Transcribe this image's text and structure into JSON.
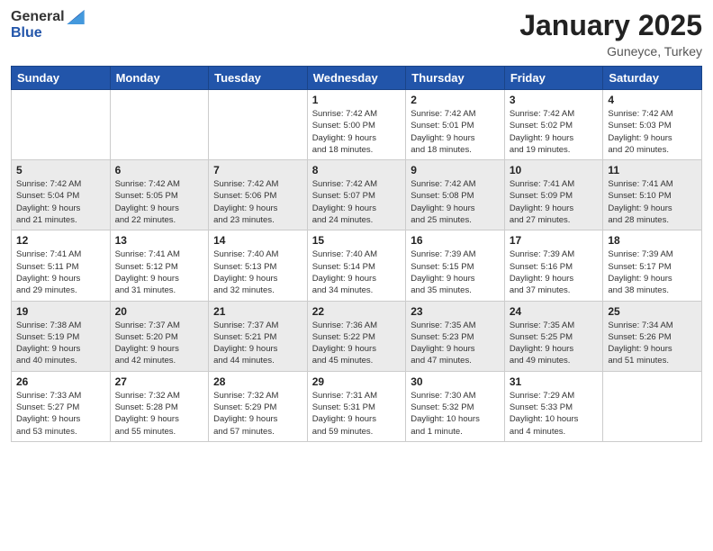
{
  "logo": {
    "general": "General",
    "blue": "Blue"
  },
  "title": "January 2025",
  "location": "Guneyce, Turkey",
  "days_of_week": [
    "Sunday",
    "Monday",
    "Tuesday",
    "Wednesday",
    "Thursday",
    "Friday",
    "Saturday"
  ],
  "weeks": [
    [
      {
        "day": "",
        "info": ""
      },
      {
        "day": "",
        "info": ""
      },
      {
        "day": "",
        "info": ""
      },
      {
        "day": "1",
        "info": "Sunrise: 7:42 AM\nSunset: 5:00 PM\nDaylight: 9 hours\nand 18 minutes."
      },
      {
        "day": "2",
        "info": "Sunrise: 7:42 AM\nSunset: 5:01 PM\nDaylight: 9 hours\nand 18 minutes."
      },
      {
        "day": "3",
        "info": "Sunrise: 7:42 AM\nSunset: 5:02 PM\nDaylight: 9 hours\nand 19 minutes."
      },
      {
        "day": "4",
        "info": "Sunrise: 7:42 AM\nSunset: 5:03 PM\nDaylight: 9 hours\nand 20 minutes."
      }
    ],
    [
      {
        "day": "5",
        "info": "Sunrise: 7:42 AM\nSunset: 5:04 PM\nDaylight: 9 hours\nand 21 minutes."
      },
      {
        "day": "6",
        "info": "Sunrise: 7:42 AM\nSunset: 5:05 PM\nDaylight: 9 hours\nand 22 minutes."
      },
      {
        "day": "7",
        "info": "Sunrise: 7:42 AM\nSunset: 5:06 PM\nDaylight: 9 hours\nand 23 minutes."
      },
      {
        "day": "8",
        "info": "Sunrise: 7:42 AM\nSunset: 5:07 PM\nDaylight: 9 hours\nand 24 minutes."
      },
      {
        "day": "9",
        "info": "Sunrise: 7:42 AM\nSunset: 5:08 PM\nDaylight: 9 hours\nand 25 minutes."
      },
      {
        "day": "10",
        "info": "Sunrise: 7:41 AM\nSunset: 5:09 PM\nDaylight: 9 hours\nand 27 minutes."
      },
      {
        "day": "11",
        "info": "Sunrise: 7:41 AM\nSunset: 5:10 PM\nDaylight: 9 hours\nand 28 minutes."
      }
    ],
    [
      {
        "day": "12",
        "info": "Sunrise: 7:41 AM\nSunset: 5:11 PM\nDaylight: 9 hours\nand 29 minutes."
      },
      {
        "day": "13",
        "info": "Sunrise: 7:41 AM\nSunset: 5:12 PM\nDaylight: 9 hours\nand 31 minutes."
      },
      {
        "day": "14",
        "info": "Sunrise: 7:40 AM\nSunset: 5:13 PM\nDaylight: 9 hours\nand 32 minutes."
      },
      {
        "day": "15",
        "info": "Sunrise: 7:40 AM\nSunset: 5:14 PM\nDaylight: 9 hours\nand 34 minutes."
      },
      {
        "day": "16",
        "info": "Sunrise: 7:39 AM\nSunset: 5:15 PM\nDaylight: 9 hours\nand 35 minutes."
      },
      {
        "day": "17",
        "info": "Sunrise: 7:39 AM\nSunset: 5:16 PM\nDaylight: 9 hours\nand 37 minutes."
      },
      {
        "day": "18",
        "info": "Sunrise: 7:39 AM\nSunset: 5:17 PM\nDaylight: 9 hours\nand 38 minutes."
      }
    ],
    [
      {
        "day": "19",
        "info": "Sunrise: 7:38 AM\nSunset: 5:19 PM\nDaylight: 9 hours\nand 40 minutes."
      },
      {
        "day": "20",
        "info": "Sunrise: 7:37 AM\nSunset: 5:20 PM\nDaylight: 9 hours\nand 42 minutes."
      },
      {
        "day": "21",
        "info": "Sunrise: 7:37 AM\nSunset: 5:21 PM\nDaylight: 9 hours\nand 44 minutes."
      },
      {
        "day": "22",
        "info": "Sunrise: 7:36 AM\nSunset: 5:22 PM\nDaylight: 9 hours\nand 45 minutes."
      },
      {
        "day": "23",
        "info": "Sunrise: 7:35 AM\nSunset: 5:23 PM\nDaylight: 9 hours\nand 47 minutes."
      },
      {
        "day": "24",
        "info": "Sunrise: 7:35 AM\nSunset: 5:25 PM\nDaylight: 9 hours\nand 49 minutes."
      },
      {
        "day": "25",
        "info": "Sunrise: 7:34 AM\nSunset: 5:26 PM\nDaylight: 9 hours\nand 51 minutes."
      }
    ],
    [
      {
        "day": "26",
        "info": "Sunrise: 7:33 AM\nSunset: 5:27 PM\nDaylight: 9 hours\nand 53 minutes."
      },
      {
        "day": "27",
        "info": "Sunrise: 7:32 AM\nSunset: 5:28 PM\nDaylight: 9 hours\nand 55 minutes."
      },
      {
        "day": "28",
        "info": "Sunrise: 7:32 AM\nSunset: 5:29 PM\nDaylight: 9 hours\nand 57 minutes."
      },
      {
        "day": "29",
        "info": "Sunrise: 7:31 AM\nSunset: 5:31 PM\nDaylight: 9 hours\nand 59 minutes."
      },
      {
        "day": "30",
        "info": "Sunrise: 7:30 AM\nSunset: 5:32 PM\nDaylight: 10 hours\nand 1 minute."
      },
      {
        "day": "31",
        "info": "Sunrise: 7:29 AM\nSunset: 5:33 PM\nDaylight: 10 hours\nand 4 minutes."
      },
      {
        "day": "",
        "info": ""
      }
    ]
  ]
}
